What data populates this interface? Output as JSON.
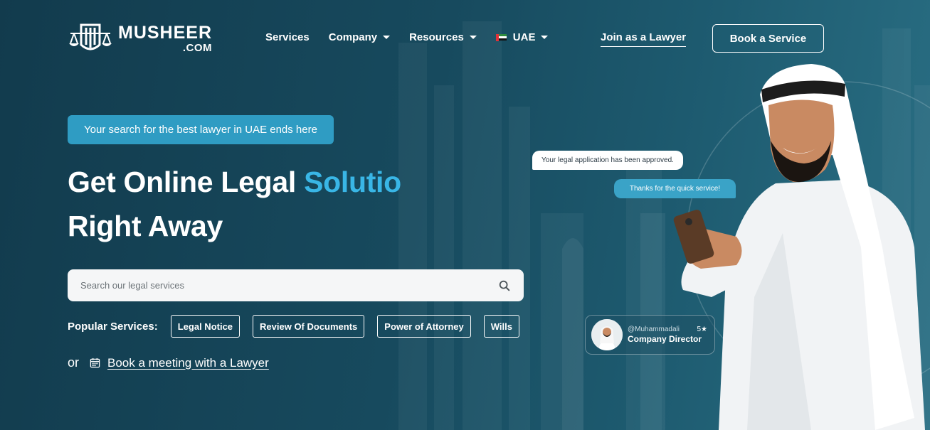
{
  "brand": {
    "name": "MUSHEER",
    "domain": ".COM",
    "logo_icon": "scales-of-justice-icon"
  },
  "nav": {
    "items": [
      {
        "label": "Services",
        "has_dropdown": false
      },
      {
        "label": "Company",
        "has_dropdown": true
      },
      {
        "label": "Resources",
        "has_dropdown": true
      },
      {
        "label": "UAE",
        "has_dropdown": true,
        "icon": "uae-flag-icon"
      }
    ],
    "join_label": "Join as a Lawyer",
    "book_label": "Book a Service"
  },
  "hero": {
    "tagline": "Your search for the best lawyer in UAE ends here",
    "title_line1_prefix": "Get Online Legal ",
    "title_line1_accent": "Solutio",
    "title_line2": "Right Away",
    "accent_color": "#39b6e6"
  },
  "search": {
    "placeholder": "Search our legal services",
    "value": "",
    "icon": "search-icon"
  },
  "popular": {
    "label": "Popular Services:",
    "chips": [
      "Legal Notice",
      "Review Of Documents",
      "Power of Attorney",
      "Wills"
    ]
  },
  "meeting": {
    "or_text": "or",
    "icon": "calendar-icon",
    "link_label": "Book a meeting with a Lawyer"
  },
  "chat": {
    "incoming": "Your legal application has been approved.",
    "outgoing": "Thanks for the quick service!"
  },
  "review": {
    "handle": "@Muhammadali",
    "role": "Company Director",
    "rating": "5★"
  },
  "colors": {
    "background": "#174a5e",
    "tagline_bg": "#2f9cc3",
    "bubble_blue": "#3aa3c7"
  }
}
